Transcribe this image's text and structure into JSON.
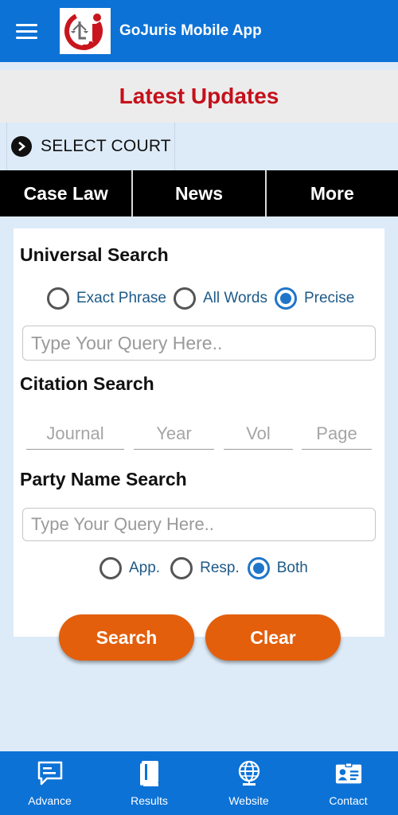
{
  "header": {
    "menu_icon": "hamburger-menu-icon",
    "logo_icon": "gojuris-logo-icon",
    "title": "GoJuris Mobile App",
    "bg_color": "#0c72d6"
  },
  "latest_updates": {
    "title": "Latest Updates",
    "color": "#c5101a"
  },
  "court_selector": {
    "icon": "chevron-right-circle-icon",
    "label": "SELECT COURT"
  },
  "tabs": [
    {
      "label": "Case Law"
    },
    {
      "label": "News"
    },
    {
      "label": "More"
    }
  ],
  "universal_search": {
    "title": "Universal Search",
    "options": [
      {
        "label": "Exact Phrase",
        "selected": false
      },
      {
        "label": "All Words",
        "selected": false
      },
      {
        "label": "Precise",
        "selected": true
      }
    ],
    "placeholder": "Type Your Query Here..",
    "value": ""
  },
  "citation_search": {
    "title": "Citation Search",
    "fields": [
      {
        "placeholder": "Journal"
      },
      {
        "placeholder": "Year"
      },
      {
        "placeholder": "Vol"
      },
      {
        "placeholder": "Page"
      }
    ]
  },
  "party_name_search": {
    "title": "Party Name Search",
    "placeholder": "Type Your Query Here..",
    "value": "",
    "options": [
      {
        "label": "App.",
        "selected": false
      },
      {
        "label": "Resp.",
        "selected": false
      },
      {
        "label": "Both",
        "selected": true
      }
    ]
  },
  "actions": {
    "search_label": "Search",
    "clear_label": "Clear",
    "button_color": "#e35f0c"
  },
  "bottom_nav": [
    {
      "label": "Advance",
      "icon": "advance-search-icon"
    },
    {
      "label": "Results",
      "icon": "book-icon"
    },
    {
      "label": "Website",
      "icon": "globe-icon"
    },
    {
      "label": "Contact",
      "icon": "contact-card-icon"
    }
  ]
}
